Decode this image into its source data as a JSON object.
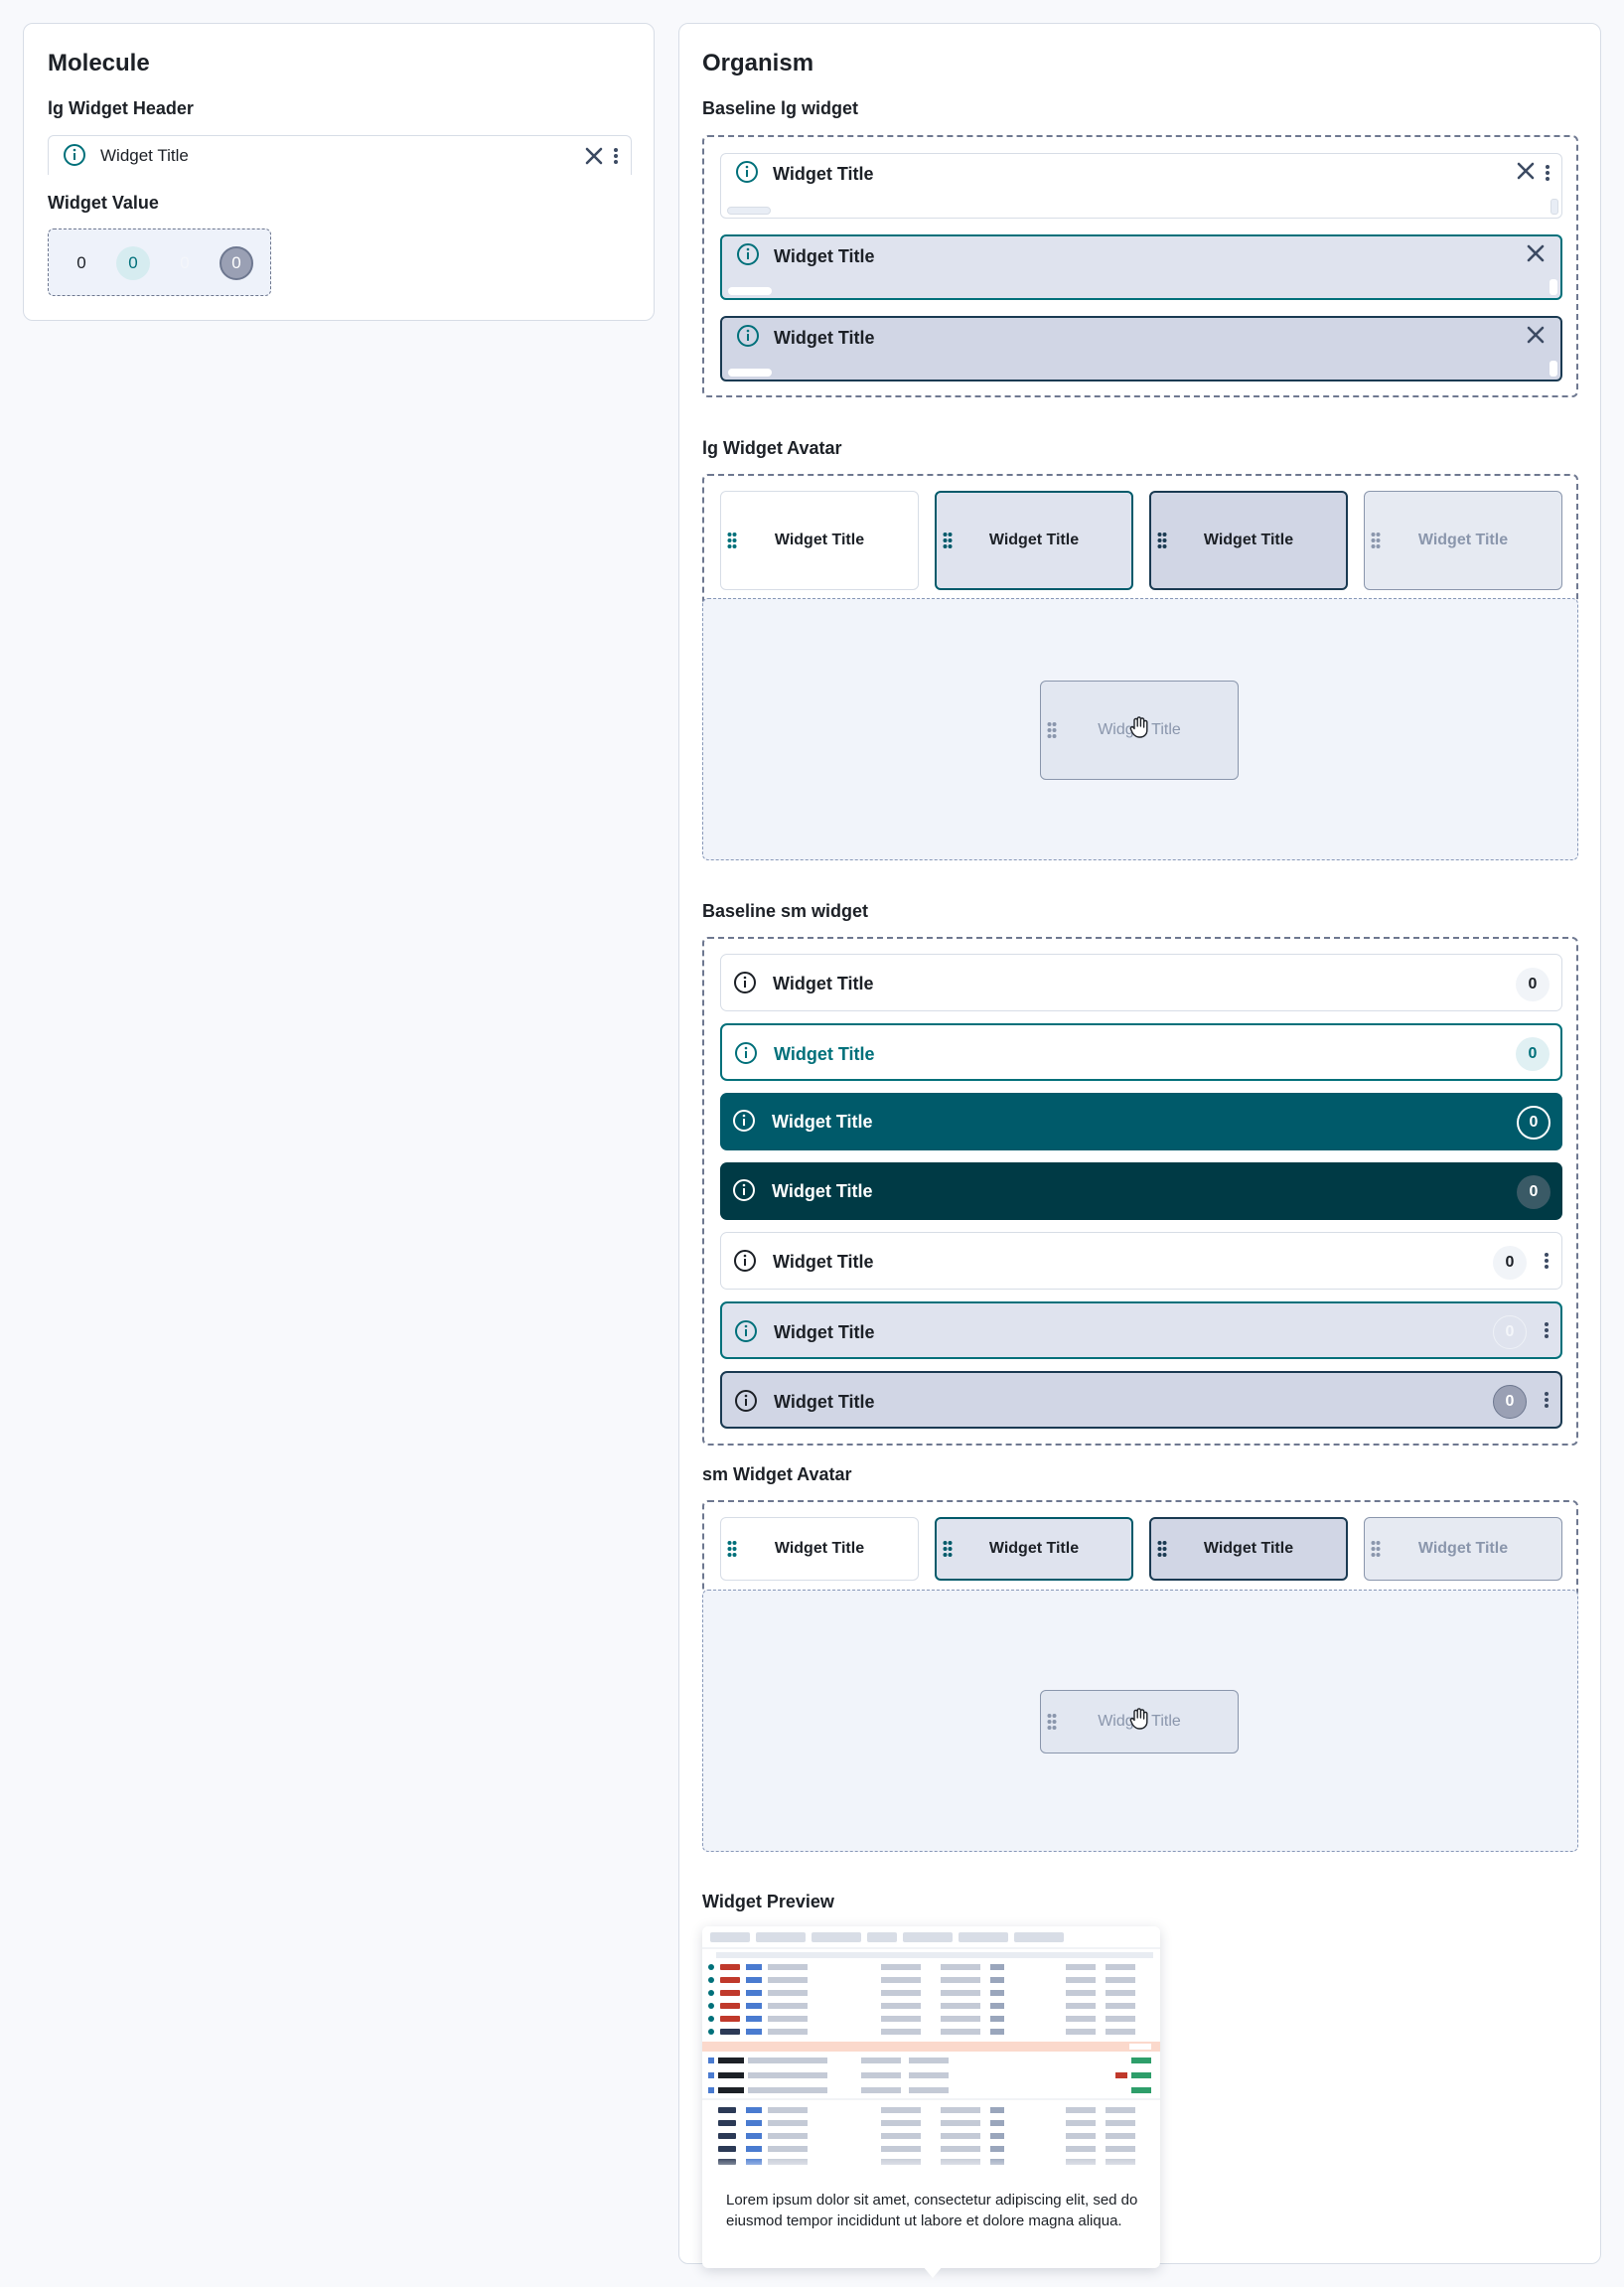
{
  "molecule": {
    "title": "Molecule",
    "header_label": "lg Widget Header",
    "header_widget_title": "Widget Title",
    "value_label": "Widget Value",
    "values": [
      "0",
      "0",
      "0",
      "0"
    ]
  },
  "organism": {
    "title": "Organism",
    "baseline_lg_label": "Baseline lg widget",
    "baseline_lg": [
      {
        "title": "Widget Title",
        "state": "default"
      },
      {
        "title": "Widget Title",
        "state": "hover"
      },
      {
        "title": "Widget Title",
        "state": "active"
      }
    ],
    "lg_avatar_label": "lg Widget Avatar",
    "lg_avatars": [
      "Widget Title",
      "Widget Title",
      "Widget Title",
      "Widget Title"
    ],
    "lg_drag_tile": "Widget Title",
    "baseline_sm_label": "Baseline sm widget",
    "baseline_sm": [
      {
        "title": "Widget Title",
        "value": "0"
      },
      {
        "title": "Widget Title",
        "value": "0"
      },
      {
        "title": "Widget Title",
        "value": "0"
      },
      {
        "title": "Widget Title",
        "value": "0"
      },
      {
        "title": "Widget Title",
        "value": "0"
      },
      {
        "title": "Widget Title",
        "value": "0"
      },
      {
        "title": "Widget Title",
        "value": "0"
      }
    ],
    "sm_avatar_label": "sm Widget Avatar",
    "sm_avatars": [
      "Widget Title",
      "Widget Title",
      "Widget Title",
      "Widget Title"
    ],
    "sm_drag_tile": "Widget Title",
    "preview_label": "Widget Preview",
    "preview_text": "Lorem ipsum dolor sit amet, consectetur adipiscing elit, sed do eiusmod tempor incididunt ut labore et dolore magna aliqua."
  },
  "colors": {
    "teal": "#00707a",
    "teal_dark": "#005a6a",
    "teal_darker": "#003a45",
    "navy": "#1a3a52",
    "hover_bg": "#dfe3ee",
    "active_bg": "#d1d6e5",
    "border": "#d7dde6"
  }
}
